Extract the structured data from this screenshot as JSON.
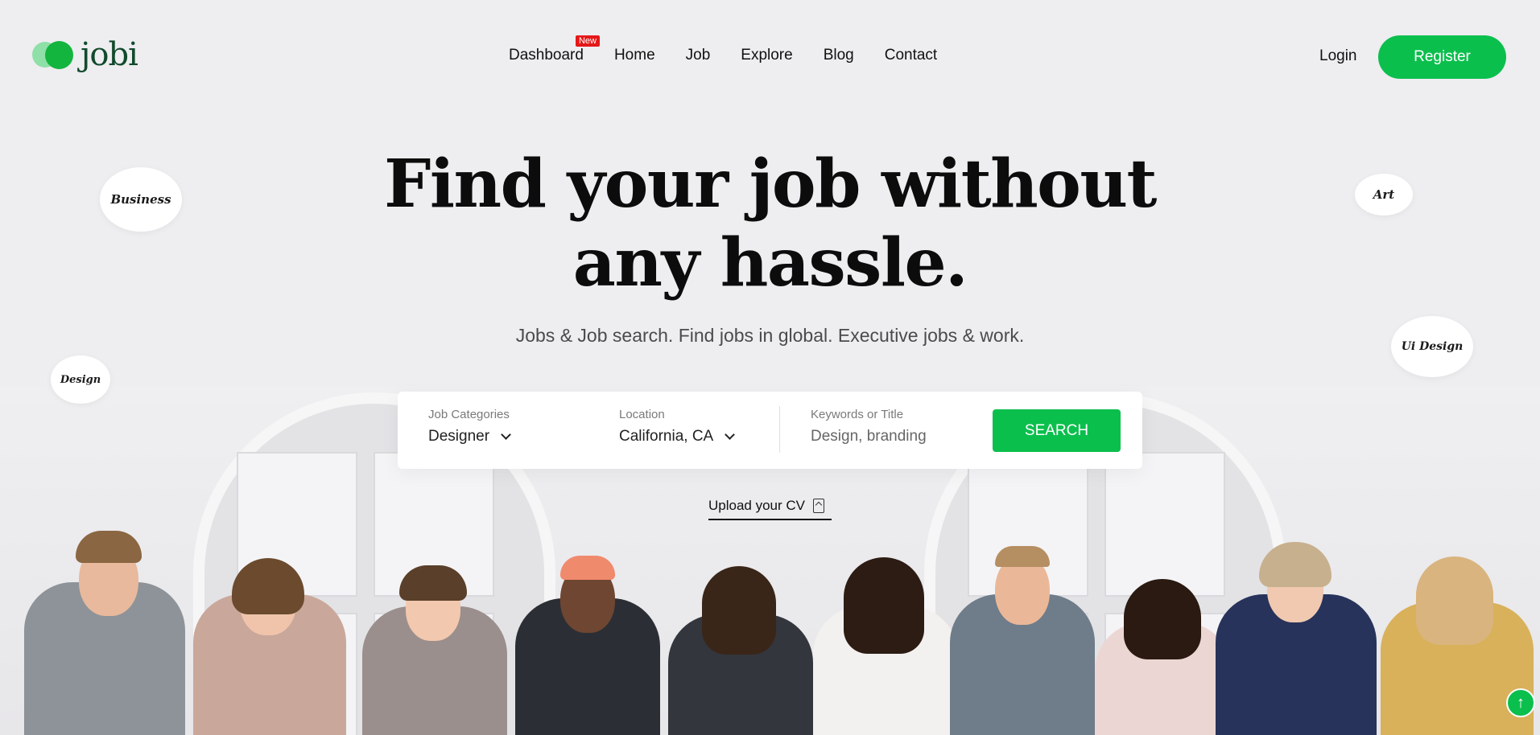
{
  "brand": {
    "name": "jobi"
  },
  "nav": {
    "items": [
      {
        "label": "Dashboard",
        "badge": "New"
      },
      {
        "label": "Home"
      },
      {
        "label": "Job"
      },
      {
        "label": "Explore"
      },
      {
        "label": "Blog"
      },
      {
        "label": "Contact"
      }
    ]
  },
  "auth": {
    "login_label": "Login",
    "register_label": "Register"
  },
  "hero": {
    "title_line1": "Find your job without",
    "title_line2": "any hassle.",
    "subtitle": "Jobs & Job search. Find jobs in global. Executive jobs & work."
  },
  "tags": [
    "Business",
    "Art",
    "Design",
    "Ui Design"
  ],
  "search": {
    "category_label": "Job Categories",
    "category_value": "Designer",
    "location_label": "Location",
    "location_value": "California, CA",
    "keyword_label": "Keywords or Title",
    "keyword_placeholder": "Design, branding",
    "button_label": "SEARCH"
  },
  "upload": {
    "label": "Upload your CV"
  },
  "colors": {
    "accent": "#0bbf4d",
    "badge": "#e51818",
    "background": "#eeedf0"
  },
  "icons": {
    "upload": "file-upload-icon",
    "scroll_top": "arrow-up-icon",
    "dropdown": "chevron-down-icon"
  }
}
